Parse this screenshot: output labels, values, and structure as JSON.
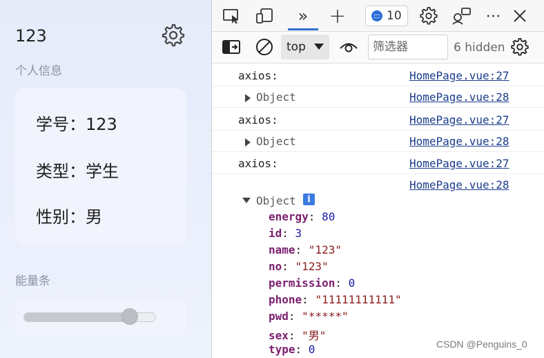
{
  "app": {
    "username": "123",
    "personal_info_label": "个人信息",
    "info": [
      {
        "label": "学号",
        "value": "123"
      },
      {
        "label": "类型",
        "value": "学生"
      },
      {
        "label": "性别",
        "value": "男"
      }
    ],
    "energy_label": "能量条",
    "energy_level_fraction": 0.8
  },
  "devtools": {
    "issues_count": "10",
    "context": "top",
    "filter_placeholder": "筛选器",
    "hidden_text": "6 hidden",
    "logs": [
      {
        "text": "axios:",
        "kind": "msg",
        "source": "HomePage.vue:27"
      },
      {
        "text": "Object",
        "kind": "obj",
        "source": "HomePage.vue:28"
      },
      {
        "text": "axios:",
        "kind": "msg",
        "source": "HomePage.vue:27"
      },
      {
        "text": "Object",
        "kind": "obj",
        "source": "HomePage.vue:28"
      },
      {
        "text": "axios:",
        "kind": "msg",
        "source": "HomePage.vue:27"
      },
      {
        "text": "",
        "kind": "msg",
        "source": "HomePage.vue:28"
      }
    ],
    "expanded_object": {
      "label": "Object",
      "info_glyph": "i",
      "properties": [
        {
          "key": "energy",
          "value": "80",
          "type": "num"
        },
        {
          "key": "id",
          "value": "3",
          "type": "num"
        },
        {
          "key": "name",
          "value": "\"123\"",
          "type": "str"
        },
        {
          "key": "no",
          "value": "\"123\"",
          "type": "str"
        },
        {
          "key": "permission",
          "value": "0",
          "type": "num"
        },
        {
          "key": "phone",
          "value": "\"11111111111\"",
          "type": "str"
        },
        {
          "key": "pwd",
          "value": "\"*****\"",
          "type": "str"
        },
        {
          "key": "sex",
          "value": "\"男\"",
          "type": "str"
        },
        {
          "key": "type",
          "value": "0",
          "type": "num"
        }
      ]
    }
  },
  "watermark": "CSDN @Penguins_0",
  "colors": {
    "accent": "#2d6fd1",
    "link": "#1a3c8a",
    "key": "#7a1f6f",
    "number": "#1c1aa6",
    "string": "#8a1c1c"
  }
}
